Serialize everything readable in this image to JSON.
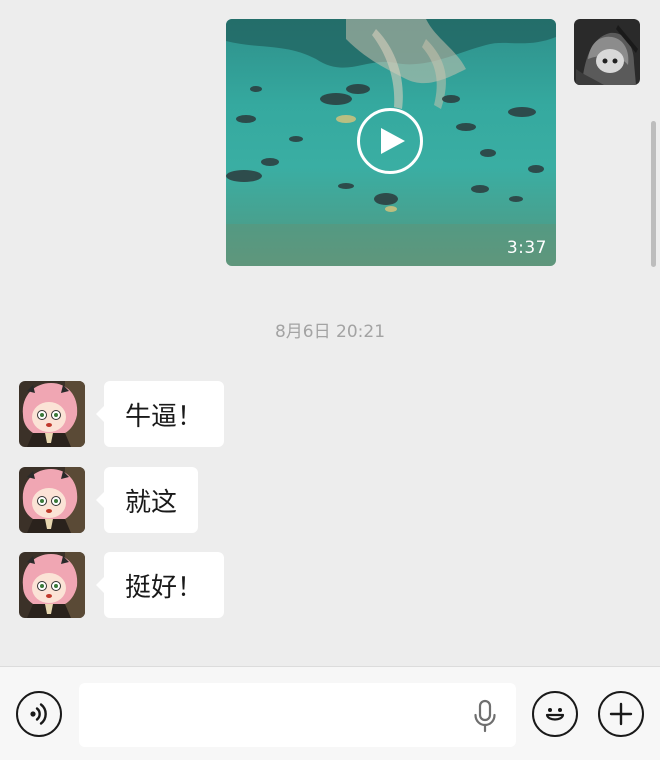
{
  "conversation": {
    "sent_video": {
      "duration": "3:37",
      "play_icon": "play-icon"
    },
    "timestamp": "8月6日 20:21",
    "received_messages": [
      {
        "text": "牛逼！"
      },
      {
        "text": "就这"
      },
      {
        "text": "挺好！"
      }
    ]
  },
  "input_bar": {
    "voice_toggle_icon": "voice-mode-icon",
    "message_input_value": "",
    "mic_icon": "microphone-icon",
    "emoji_icon": "emoji-icon",
    "more_icon": "plus-icon"
  },
  "colors": {
    "background": "#ededed",
    "bubble": "#ffffff",
    "text": "#191919",
    "timestamp": "#a3a3a3"
  }
}
